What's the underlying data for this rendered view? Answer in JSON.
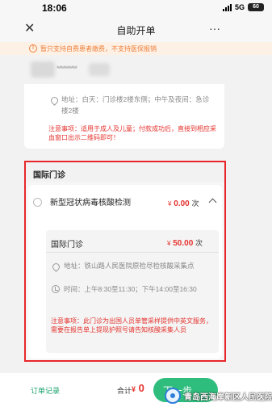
{
  "status_bar": {
    "time": "18:06",
    "network": "5G",
    "battery": "60"
  },
  "nav": {
    "title": "自助开单",
    "close_glyph": "✕",
    "more_glyph": "···"
  },
  "notice": {
    "text": "暂只支持自费患者缴费，不支持医保报销",
    "icon_glyph": "!"
  },
  "patient": {
    "masked_id": "**********"
  },
  "previous_card": {
    "address": "地址：白天：门诊楼2楼东侧；中午及夜间：急诊楼2楼",
    "caution": "注意事项：适用于成人及儿童；付款成功后，直接到相应采血窗口出示二维码即可！"
  },
  "international": {
    "section_title": "国际门诊",
    "item": {
      "name": "新型冠状病毒核酸检测",
      "price_symbol": "¥",
      "price": "0.00",
      "unit": "次",
      "sub": {
        "name": "国际门诊",
        "price_symbol": "¥",
        "price": "50.00",
        "unit": "次",
        "address": "地址：铁山路人民医院原检尽检核酸采集点",
        "time": "时间：上午8:30至11:30；下午14:00至16:30",
        "caution": "注意事项：此门诊为出国人员单管采样提供中英文服务，需要在报告单上提现护照号请告知核酸采集人员"
      }
    }
  },
  "footer": {
    "order_record": "订单记录",
    "total_label": "合计",
    "total_symbol": "¥",
    "total_value": "0",
    "submit": "下一步"
  },
  "watermark": {
    "text": "青岛西海岸新区人民医院"
  },
  "colors": {
    "accent_green": "#2fbd7d",
    "price_red": "#e5322d",
    "notice_orange": "#ef7f3c",
    "highlight_border": "#e8262a"
  }
}
